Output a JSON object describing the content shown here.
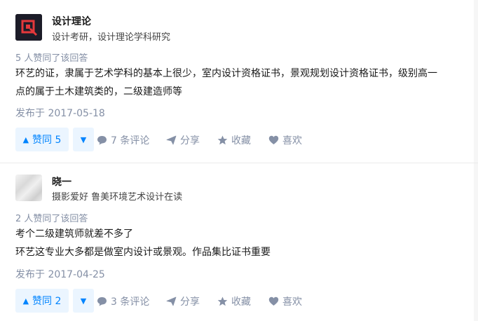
{
  "answers": [
    {
      "author_name": "设计理论",
      "author_bio": "设计考研，设计理论学科研究",
      "votes_text": "5 人赞同了该回答",
      "content_lines": [
        "环艺的证，隶属于艺术学科的基本上很少，室内设计资格证书，景观规划设计资格证书，级别高一",
        "点的属于土木建筑类的，二级建造师等"
      ],
      "date": "发布于 2017-05-18",
      "vote_up_label": "赞同 5",
      "comment_label": "7 条评论",
      "share_label": "分享",
      "favorite_label": "收藏",
      "like_label": "喜欢"
    },
    {
      "author_name": "晓一",
      "author_bio": "摄影爱好 鲁美环境艺术设计在读",
      "votes_text": "2 人赞同了该回答",
      "content_lines": [
        "考个二级建筑师就差不多了",
        "环艺这专业大多都是做室内设计或景观。作品集比证书重要"
      ],
      "date": "发布于 2017-04-25",
      "vote_up_label": "赞同 2",
      "comment_label": "3 条评论",
      "share_label": "分享",
      "favorite_label": "收藏",
      "like_label": "喜欢"
    }
  ],
  "colors": {
    "accent": "#0084ff",
    "accent_bg": "#ebf5ff",
    "meta_gray": "#8590a6",
    "logo_bg": "#1c1c28",
    "logo_red": "#e5383b"
  },
  "icons": {
    "vote_up": "triangle-up-icon",
    "vote_down": "triangle-down-icon",
    "comment": "comment-bubble-icon",
    "share": "paper-plane-icon",
    "favorite": "star-icon",
    "like": "heart-icon"
  }
}
